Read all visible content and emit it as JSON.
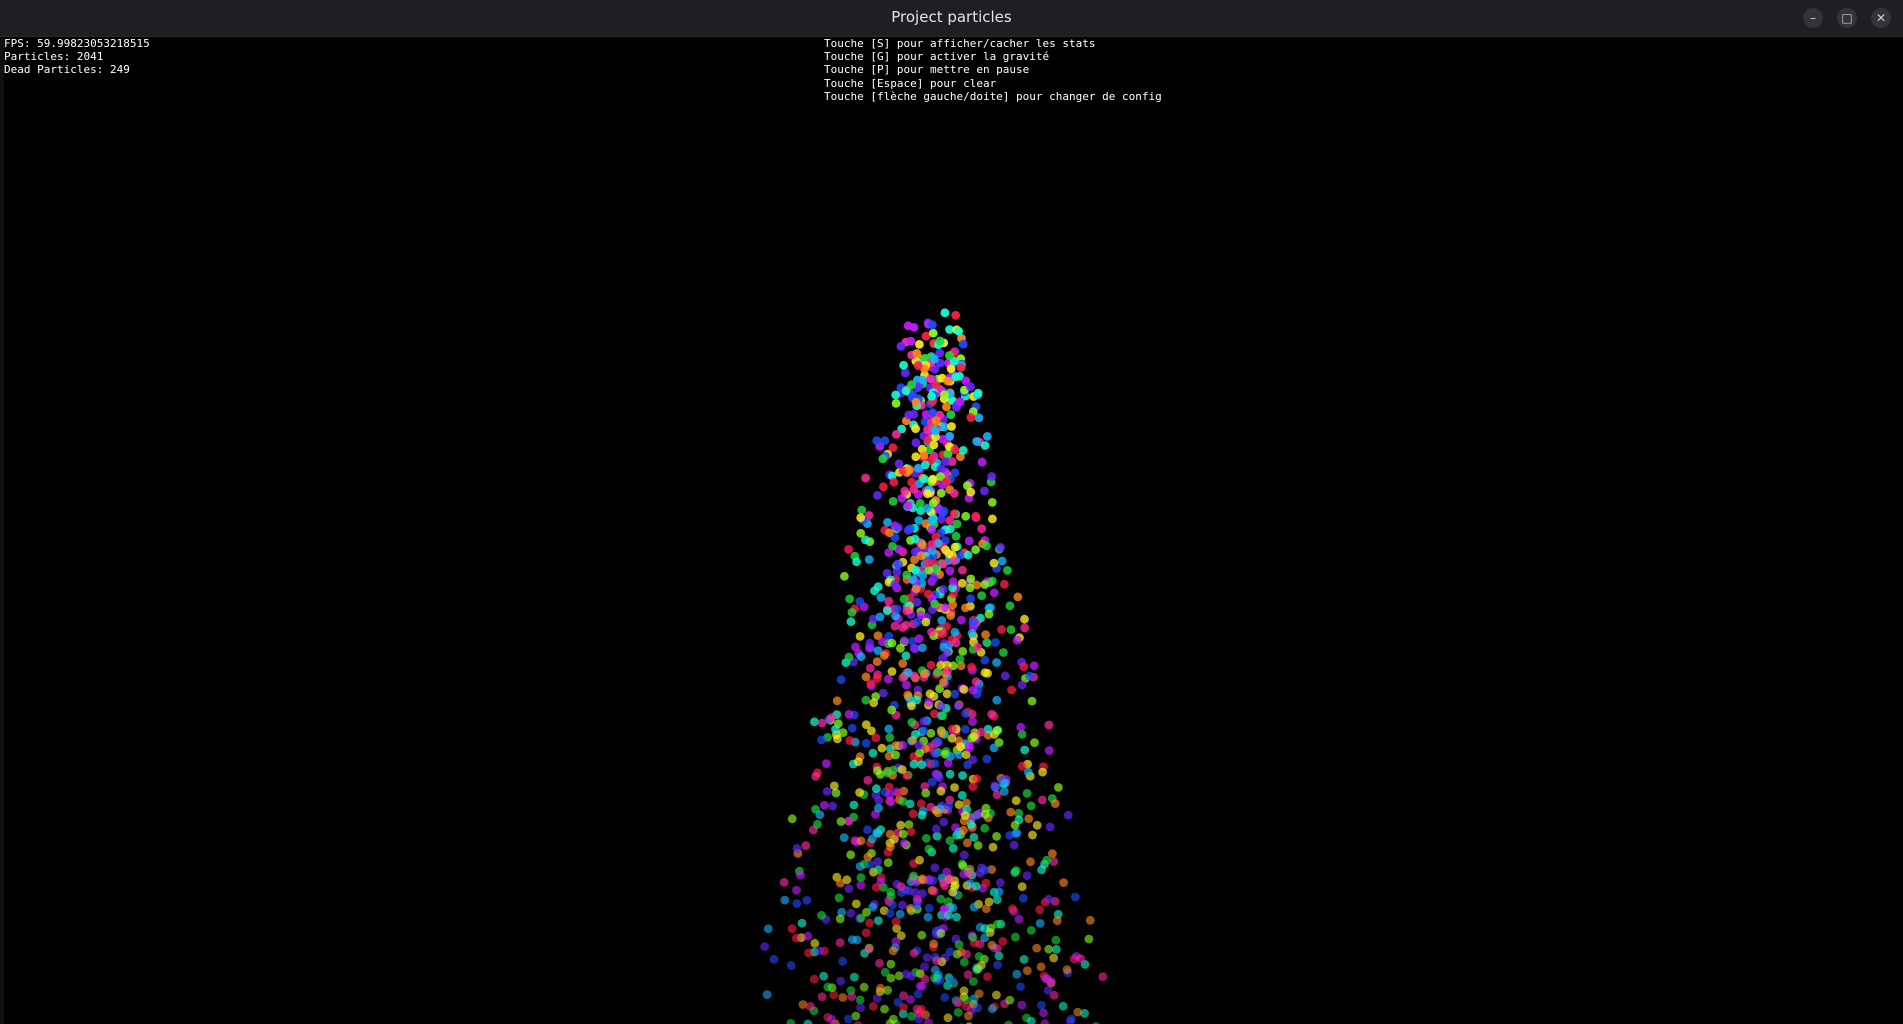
{
  "window": {
    "title": "Project particles",
    "minimize_glyph": "–",
    "maximize_glyph": "□",
    "close_glyph": "✕"
  },
  "stats": {
    "fps": "FPS: 59.99823053218515",
    "particles": "Particles: 2041",
    "dead": "Dead Particles: 249"
  },
  "help": {
    "lines": [
      "Touche [S] pour afficher/cacher les stats",
      "Touche [G] pour activer la gravité",
      "Touche [P] pour mettre en pause",
      "Touche [Espace] pour clear",
      "Touche [flèche gauche/doite] pour changer de config"
    ]
  },
  "particle_palette": [
    "#ff1e46",
    "#ff2aa0",
    "#c21cff",
    "#6a28ff",
    "#1e4cff",
    "#18b4ff",
    "#14ffd2",
    "#1edc3c",
    "#8cff1e",
    "#ffee1e",
    "#ff8a1e"
  ]
}
